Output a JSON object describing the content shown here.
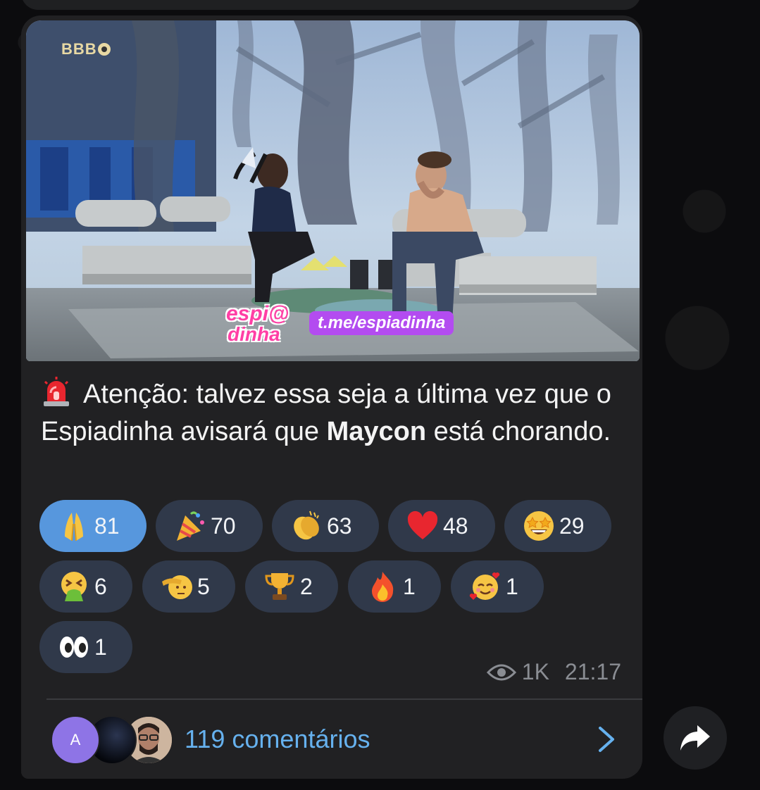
{
  "media": {
    "watermark": "BBB",
    "channel_link": "t.me/espiadinha",
    "logo_text": [
      "espi@",
      "dinha"
    ]
  },
  "caption": {
    "pre": "Atenção: talvez essa seja a última vez que o Espiadinha avisará que ",
    "bold": "Maycon",
    "post": " está chorando.",
    "icon": "rotating-light-icon"
  },
  "reactions": [
    {
      "emoji": "folded-hands",
      "count": "81",
      "active": true
    },
    {
      "emoji": "party-popper",
      "count": "70",
      "active": false
    },
    {
      "emoji": "clapping-hands",
      "count": "63",
      "active": false
    },
    {
      "emoji": "red-heart",
      "count": "48",
      "active": false
    },
    {
      "emoji": "star-struck",
      "count": "29",
      "active": false
    },
    {
      "emoji": "vomiting-face",
      "count": "6",
      "active": false
    },
    {
      "emoji": "saluting-face",
      "count": "5",
      "active": false
    },
    {
      "emoji": "trophy",
      "count": "2",
      "active": false
    },
    {
      "emoji": "fire",
      "count": "1",
      "active": false
    },
    {
      "emoji": "smiling-face-with-hearts",
      "count": "1",
      "active": false
    },
    {
      "emoji": "eyes",
      "count": "1",
      "active": false
    }
  ],
  "meta": {
    "views": "1K",
    "time": "21:17"
  },
  "comments": {
    "avatar_initial": "A",
    "label": "119 comentários"
  },
  "colors": {
    "bubble": "#212123",
    "reaction_bg": "#30394a",
    "reaction_active": "#5797dd",
    "link": "#66b1ee"
  }
}
